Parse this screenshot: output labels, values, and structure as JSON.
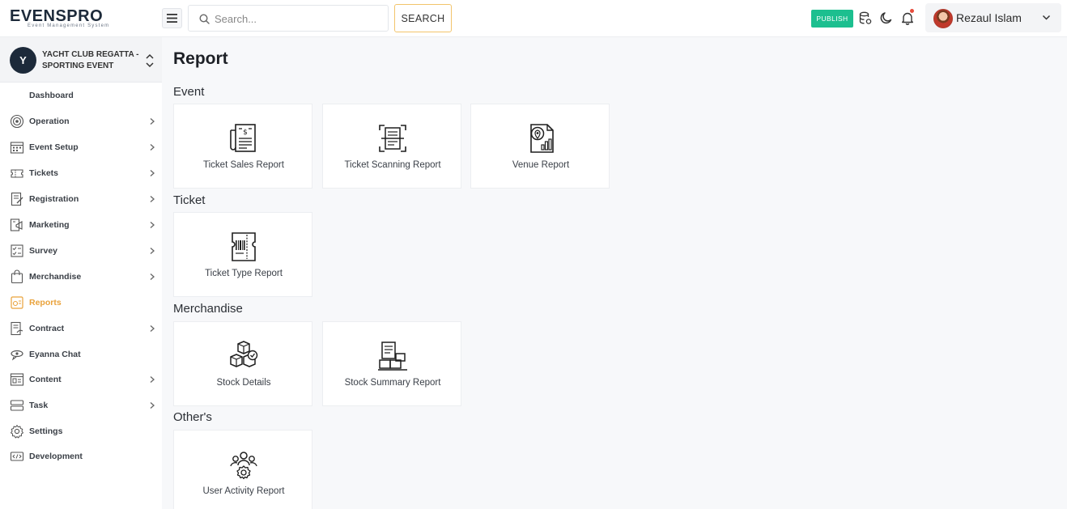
{
  "header": {
    "logo_text": "EVENSPRO",
    "logo_tagline": "Event Management System",
    "search_placeholder": "Search...",
    "search_button": "SEARCH",
    "publish_button": "PUBLISH",
    "user_name": "Rezaul Islam"
  },
  "sidebar": {
    "event_initial": "Y",
    "event_name": "YACHT CLUB REGATTA - SPORTING EVENT",
    "items": [
      {
        "label": "Dashboard",
        "icon": "dashboard-icon",
        "has_submenu": false
      },
      {
        "label": "Operation",
        "icon": "operation-icon",
        "has_submenu": true
      },
      {
        "label": "Event Setup",
        "icon": "calendar-icon",
        "has_submenu": true
      },
      {
        "label": "Tickets",
        "icon": "ticket-icon",
        "has_submenu": true
      },
      {
        "label": "Registration",
        "icon": "registration-icon",
        "has_submenu": true
      },
      {
        "label": "Marketing",
        "icon": "marketing-icon",
        "has_submenu": true
      },
      {
        "label": "Survey",
        "icon": "survey-icon",
        "has_submenu": true
      },
      {
        "label": "Merchandise",
        "icon": "shopping-bag-icon",
        "has_submenu": true
      },
      {
        "label": "Reports",
        "icon": "reports-icon",
        "has_submenu": false,
        "active": true
      },
      {
        "label": "Contract",
        "icon": "contract-icon",
        "has_submenu": true
      },
      {
        "label": "Eyanna Chat",
        "icon": "chat-icon",
        "has_submenu": false
      },
      {
        "label": "Content",
        "icon": "content-icon",
        "has_submenu": true
      },
      {
        "label": "Task",
        "icon": "task-icon",
        "has_submenu": true
      },
      {
        "label": "Settings",
        "icon": "gear-icon",
        "has_submenu": false
      },
      {
        "label": "Development",
        "icon": "development-icon",
        "has_submenu": false
      }
    ]
  },
  "main": {
    "title": "Report",
    "sections": [
      {
        "title": "Event",
        "cards": [
          {
            "label": "Ticket Sales Report",
            "icon": "sales-report-icon"
          },
          {
            "label": "Ticket Scanning Report",
            "icon": "scan-report-icon"
          },
          {
            "label": "Venue Report",
            "icon": "venue-report-icon"
          }
        ]
      },
      {
        "title": "Ticket",
        "cards": [
          {
            "label": "Ticket Type Report",
            "icon": "ticket-type-icon"
          }
        ]
      },
      {
        "title": "Merchandise",
        "cards": [
          {
            "label": "Stock Details",
            "icon": "stock-boxes-icon"
          },
          {
            "label": "Stock Summary Report",
            "icon": "stock-summary-icon"
          }
        ]
      },
      {
        "title": "Other's",
        "cards": [
          {
            "label": "User Activity Report",
            "icon": "user-activity-icon"
          }
        ]
      }
    ]
  },
  "colors": {
    "accent": "#e9a23b",
    "publish": "#1cbf8f",
    "dark": "#1d2a3a"
  }
}
